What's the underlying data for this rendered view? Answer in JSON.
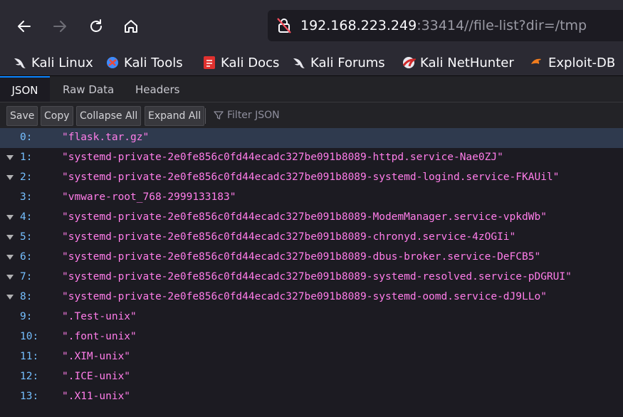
{
  "browser": {
    "url_host": "192.168.223.249",
    "url_rest": ":33414//file-list?dir=/tmp",
    "accent": "#0a84ff"
  },
  "bookmarks": [
    {
      "label": "Kali Linux",
      "icon": "kali-dragon-icon"
    },
    {
      "label": "Kali Tools",
      "icon": "kali-tools-icon"
    },
    {
      "label": "Kali Docs",
      "icon": "kali-docs-icon"
    },
    {
      "label": "Kali Forums",
      "icon": "kali-dragon-icon"
    },
    {
      "label": "Kali NetHunter",
      "icon": "nethunter-icon"
    },
    {
      "label": "Exploit-DB",
      "icon": "exploit-db-icon"
    }
  ],
  "viewer": {
    "tabs": [
      "JSON",
      "Raw Data",
      "Headers"
    ],
    "toolbar": {
      "save": "Save",
      "copy": "Copy",
      "collapse_all": "Collapse All",
      "expand_all": "Expand All",
      "filter_placeholder": "Filter JSON"
    },
    "rows": [
      {
        "key": "0:",
        "value": "\"flask.tar.gz\""
      },
      {
        "key": "1:",
        "value": "\"systemd-private-2e0fe856c0fd44ecadc327be091b8089-httpd.service-Nae0ZJ\""
      },
      {
        "key": "2:",
        "value": "\"systemd-private-2e0fe856c0fd44ecadc327be091b8089-systemd-logind.service-FKAUil\""
      },
      {
        "key": "3:",
        "value": "\"vmware-root_768-2999133183\""
      },
      {
        "key": "4:",
        "value": "\"systemd-private-2e0fe856c0fd44ecadc327be091b8089-ModemManager.service-vpkdWb\""
      },
      {
        "key": "5:",
        "value": "\"systemd-private-2e0fe856c0fd44ecadc327be091b8089-chronyd.service-4zOGIi\""
      },
      {
        "key": "6:",
        "value": "\"systemd-private-2e0fe856c0fd44ecadc327be091b8089-dbus-broker.service-DeFCB5\""
      },
      {
        "key": "7:",
        "value": "\"systemd-private-2e0fe856c0fd44ecadc327be091b8089-systemd-resolved.service-pDGRUI\""
      },
      {
        "key": "8:",
        "value": "\"systemd-private-2e0fe856c0fd44ecadc327be091b8089-systemd-oomd.service-dJ9LLo\""
      },
      {
        "key": "9:",
        "value": "\".Test-unix\""
      },
      {
        "key": "10:",
        "value": "\".font-unix\""
      },
      {
        "key": "11:",
        "value": "\".XIM-unix\""
      },
      {
        "key": "12:",
        "value": "\".ICE-unix\""
      },
      {
        "key": "13:",
        "value": "\".X11-unix\""
      }
    ]
  }
}
